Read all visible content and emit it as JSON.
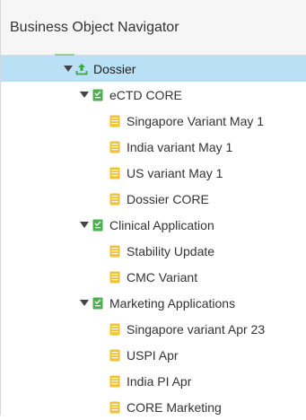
{
  "header": {
    "title": "Business Object Navigator"
  },
  "colors": {
    "selected_row": "#b9e0f5",
    "header_bg": "#f6f6f6",
    "folder_green": "#4caf50",
    "doc_yellow": "#f1c232"
  },
  "tree": {
    "root": {
      "label": "Dossier",
      "icon": "upload-icon",
      "expanded": true,
      "selected": true
    },
    "groups": [
      {
        "label": "eCTD CORE",
        "icon": "green-document-icon",
        "expanded": true,
        "items": [
          {
            "label": "Singapore Variant May 1",
            "icon": "yellow-document-icon"
          },
          {
            "label": "India variant May 1",
            "icon": "yellow-document-icon"
          },
          {
            "label": "US variant May 1",
            "icon": "yellow-document-icon"
          },
          {
            "label": "Dossier CORE",
            "icon": "yellow-document-icon"
          }
        ]
      },
      {
        "label": "Clinical Application",
        "icon": "green-document-icon",
        "expanded": true,
        "items": [
          {
            "label": "Stability Update",
            "icon": "yellow-document-icon"
          },
          {
            "label": "CMC Variant",
            "icon": "yellow-document-icon"
          }
        ]
      },
      {
        "label": "Marketing Applications",
        "icon": "green-document-icon",
        "expanded": true,
        "items": [
          {
            "label": "Singapore variant Apr 23",
            "icon": "yellow-document-icon"
          },
          {
            "label": "USPI Apr",
            "icon": "yellow-document-icon"
          },
          {
            "label": "India PI Apr",
            "icon": "yellow-document-icon"
          },
          {
            "label": "CORE Marketing",
            "icon": "yellow-document-icon"
          }
        ]
      }
    ]
  }
}
